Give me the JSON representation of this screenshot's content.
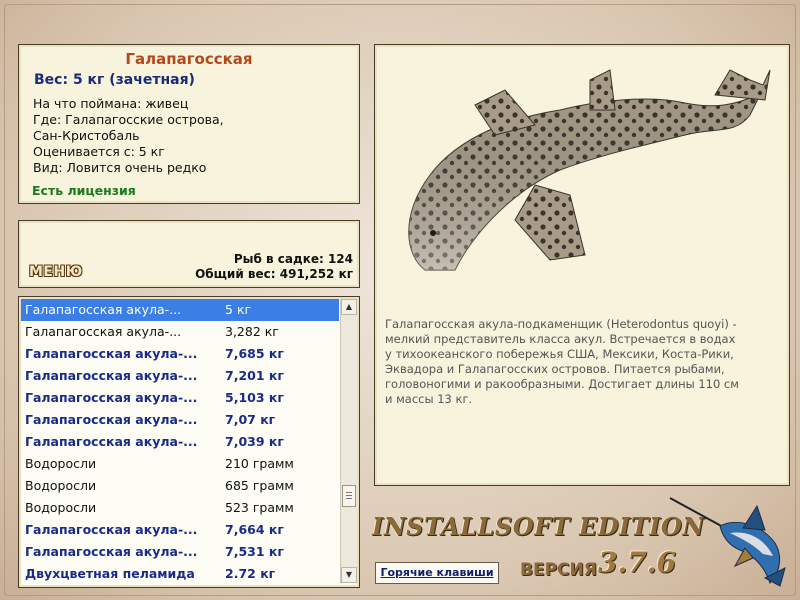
{
  "info": {
    "title": "Галапагосская",
    "weight": "Вес: 5 кг (зачетная)",
    "bait": "На что поймана: живец",
    "location_1": "Где: Галапагосские острова,",
    "location_2": "Сан-Кристобаль",
    "rated_from": "Оценивается с: 5 кг",
    "species_note": "Вид: Ловится очень редко",
    "license": "Есть лицензия"
  },
  "stats": {
    "menu_label": "МЕНЮ",
    "fish_in_keepnet": "Рыб в садке: 124",
    "total_weight": "Общий вес: 491,252 кг"
  },
  "catch_list": [
    {
      "name": "Галапагосская акула-...",
      "weight": "5 кг",
      "style": "selected"
    },
    {
      "name": "Галапагосская акула-...",
      "weight": "3,282 кг",
      "style": "plain"
    },
    {
      "name": "Галапагосская акула-...",
      "weight": "7,685 кг",
      "style": "hl"
    },
    {
      "name": "Галапагосская акула-...",
      "weight": "7,201 кг",
      "style": "hl"
    },
    {
      "name": "Галапагосская акула-...",
      "weight": "5,103 кг",
      "style": "hl"
    },
    {
      "name": "Галапагосская акула-...",
      "weight": "7,07 кг",
      "style": "hl"
    },
    {
      "name": "Галапагосская акула-...",
      "weight": "7,039 кг",
      "style": "hl"
    },
    {
      "name": "Водоросли",
      "weight": "210 грамм",
      "style": "plain"
    },
    {
      "name": "Водоросли",
      "weight": "685 грамм",
      "style": "plain"
    },
    {
      "name": "Водоросли",
      "weight": "523 грамм",
      "style": "plain"
    },
    {
      "name": "Галапагосская акула-...",
      "weight": "7,664 кг",
      "style": "hl"
    },
    {
      "name": "Галапагосская акула-...",
      "weight": "7,531 кг",
      "style": "hl"
    },
    {
      "name": "Двухцветная пеламида",
      "weight": "2.72 кг",
      "style": "hl"
    }
  ],
  "description": "Галапагосская акула-подкаменщик (Heterodontus quoyi) - мелкий представитель класса акул. Встречается в водах у тихоокеанского побережья США, Мексики, Коста-Рики, Эквадора и Галапагосских островов. Питается рыбами, головоногими и ракообразными. Достигает длины 110 см и массы 13 кг.",
  "hotkeys_label": "Горячие клавиши",
  "edition": "INSTALLSOFT EDITION",
  "version_label": "ВЕРСИЯ",
  "version_number": "3.7.6",
  "colors": {
    "title": "#b5471c",
    "weight_text": "#1d2a7a",
    "license_text": "#1b7a1b",
    "selection": "#3b7ee6",
    "panel_bg": "#f7f3dc"
  },
  "icons": {
    "scroll_up": "triangle-up-icon",
    "scroll_down": "triangle-down-icon",
    "logo": "marlin-icon"
  }
}
